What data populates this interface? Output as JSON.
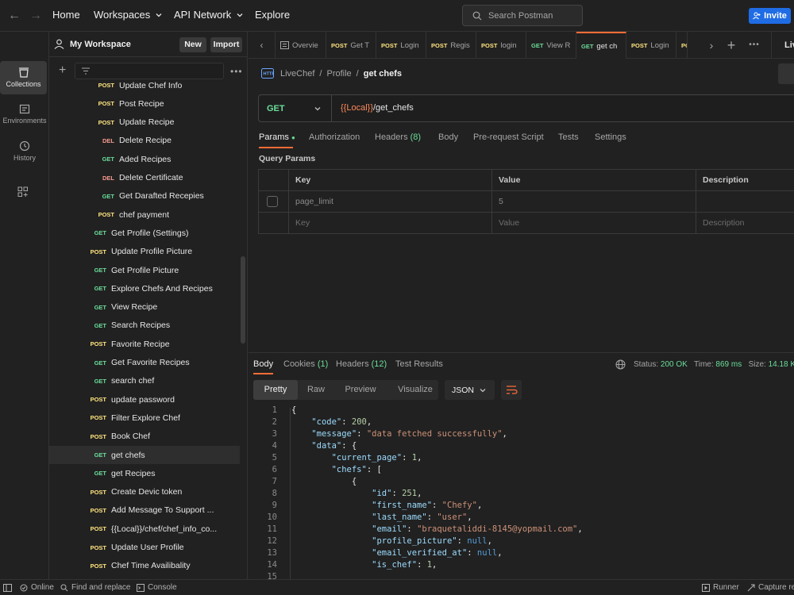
{
  "topbar": {
    "home": "Home",
    "workspaces": "Workspaces",
    "api_network": "API Network",
    "explore": "Explore",
    "search_placeholder": "Search Postman",
    "invite": "Invite"
  },
  "rail": [
    {
      "label": "Collections",
      "icon": "collections-icon"
    },
    {
      "label": "Environments",
      "icon": "environments-icon"
    },
    {
      "label": "History",
      "icon": "history-icon"
    }
  ],
  "workspace": {
    "title": "My Workspace",
    "new_label": "New",
    "import_label": "Import",
    "items": [
      {
        "method": "POST",
        "name": "Update Chef Info",
        "indent": 2
      },
      {
        "method": "POST",
        "name": "Post Recipe",
        "indent": 2
      },
      {
        "method": "POST",
        "name": "Update Recipe",
        "indent": 2
      },
      {
        "method": "DEL",
        "name": "Delete Recipe",
        "indent": 2
      },
      {
        "method": "GET",
        "name": "Aded Recipes",
        "indent": 2
      },
      {
        "method": "DEL",
        "name": "Delete Certificate",
        "indent": 2
      },
      {
        "method": "GET",
        "name": "Get Darafted Recepies",
        "indent": 2
      },
      {
        "method": "POST",
        "name": "chef payment",
        "indent": 2
      },
      {
        "method": "GET",
        "name": "Get Profile (Settings)",
        "indent": 1
      },
      {
        "method": "POST",
        "name": "Update Profile Picture",
        "indent": 1
      },
      {
        "method": "GET",
        "name": "Get Profile Picture",
        "indent": 1
      },
      {
        "method": "GET",
        "name": "Explore Chefs And Recipes",
        "indent": 1
      },
      {
        "method": "GET",
        "name": "View Recipe",
        "indent": 1
      },
      {
        "method": "GET",
        "name": "Search Recipes",
        "indent": 1
      },
      {
        "method": "POST",
        "name": "Favorite Recipe",
        "indent": 1
      },
      {
        "method": "GET",
        "name": "Get Favorite Recipes",
        "indent": 1
      },
      {
        "method": "GET",
        "name": "search chef",
        "indent": 1
      },
      {
        "method": "POST",
        "name": "update password",
        "indent": 1
      },
      {
        "method": "POST",
        "name": "Filter Explore Chef",
        "indent": 1
      },
      {
        "method": "POST",
        "name": "Book Chef",
        "indent": 1
      },
      {
        "method": "GET",
        "name": "get chefs",
        "indent": 1
      },
      {
        "method": "GET",
        "name": "get Recipes",
        "indent": 1
      },
      {
        "method": "POST",
        "name": "Create Devic token",
        "indent": 1
      },
      {
        "method": "POST",
        "name": "Add Message To Support ...",
        "indent": 1
      },
      {
        "method": "POST",
        "name": "{{Local}}/chef/chef_info_co...",
        "indent": 1
      },
      {
        "method": "POST",
        "name": "Update User Profile",
        "indent": 1
      },
      {
        "method": "POST",
        "name": "Chef Time Availibality",
        "indent": 1
      }
    ]
  },
  "tabs": [
    {
      "method": "",
      "label": "Overvie"
    },
    {
      "method": "POST",
      "label": "Get T"
    },
    {
      "method": "POST",
      "label": "Login"
    },
    {
      "method": "POST",
      "label": "Regis"
    },
    {
      "method": "POST",
      "label": "login"
    },
    {
      "method": "GET",
      "label": "View R"
    },
    {
      "method": "GET",
      "label": "get ch"
    },
    {
      "method": "POST",
      "label": "Login"
    },
    {
      "method": "POS",
      "label": ""
    }
  ],
  "tab_env": "Live",
  "request": {
    "breadcrumb": [
      "LiveChef",
      "Profile",
      "get chefs"
    ],
    "method": "GET",
    "url_var": "{{Local}}",
    "url_path": "/get_chefs",
    "subtabs": [
      "Params",
      "Authorization",
      "Headers",
      "(8)",
      "Body",
      "Pre-request Script",
      "Tests",
      "Settings"
    ],
    "query_params_title": "Query Params",
    "table_headers": [
      "Key",
      "Value",
      "Description"
    ],
    "rows": [
      {
        "key": "page_limit",
        "value": "5",
        "description": ""
      },
      {
        "key": "Key",
        "value": "Value",
        "description": "Description"
      }
    ]
  },
  "response": {
    "tabs": [
      "Body",
      "Cookies",
      "(1)",
      "Headers",
      "(12)",
      "Test Results"
    ],
    "status_label": "Status:",
    "status": "200 OK",
    "time_label": "Time:",
    "time": "869 ms",
    "size_label": "Size:",
    "size": "14.18 K",
    "view_tabs": [
      "Pretty",
      "Raw",
      "Preview",
      "Visualize"
    ],
    "format": "JSON",
    "lines": [
      {
        "n": "1",
        "t": "{"
      },
      {
        "n": "2",
        "t": "    \"code\": 200,"
      },
      {
        "n": "3",
        "t": "    \"message\": \"data fetched successfully\","
      },
      {
        "n": "4",
        "t": "    \"data\": {"
      },
      {
        "n": "5",
        "t": "        \"current_page\": 1,"
      },
      {
        "n": "6",
        "t": "        \"chefs\": ["
      },
      {
        "n": "7",
        "t": "            {"
      },
      {
        "n": "8",
        "t": "                \"id\": 251,"
      },
      {
        "n": "9",
        "t": "                \"first_name\": \"Chefy\","
      },
      {
        "n": "10",
        "t": "                \"last_name\": \"user\","
      },
      {
        "n": "11",
        "t": "                \"email\": \"braquetaliddi-8145@yopmail.com\","
      },
      {
        "n": "12",
        "t": "                \"profile_picture\": null,"
      },
      {
        "n": "13",
        "t": "                \"email_verified_at\": null,"
      },
      {
        "n": "14",
        "t": "                \"is_chef\": 1,"
      },
      {
        "n": "15",
        "t": ""
      }
    ]
  },
  "statusbar": {
    "online": "Online",
    "find_replace": "Find and replace",
    "console": "Console",
    "runner": "Runner",
    "capture": "Capture re"
  }
}
